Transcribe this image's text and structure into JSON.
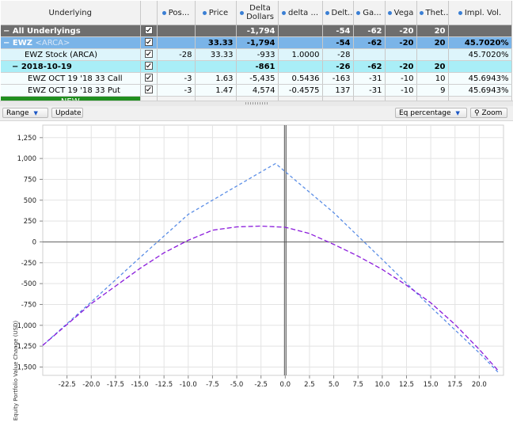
{
  "table": {
    "headers": {
      "underlying": "Underlying",
      "position": "Pos...",
      "price": "Price",
      "delta_dollars_1": "Delta",
      "delta_dollars_2": "Dollars",
      "delta_pct": "delta ...",
      "delta": "Delt...",
      "gamma": "Ga...",
      "vega": "Vega",
      "theta": "Thet...",
      "impl_vol": "Impl. Vol."
    },
    "rows": [
      {
        "type": "all",
        "name": "All Underlyings",
        "exch": "",
        "checked": true,
        "pos": "",
        "price": "",
        "ddollars": "-1,794",
        "dpct": "",
        "delta": "-54",
        "gamma": "-62",
        "vega": "-20",
        "theta": "20",
        "iv": ""
      },
      {
        "type": "ewz",
        "name": "EWZ",
        "exch": "<ARCA>",
        "checked": true,
        "pos": "",
        "price": "33.33",
        "ddollars": "-1,794",
        "dpct": "",
        "delta": "-54",
        "gamma": "-62",
        "vega": "-20",
        "theta": "20",
        "iv": "45.7020%"
      },
      {
        "type": "stock",
        "name": "EWZ Stock (ARCA)",
        "exch": "",
        "checked": true,
        "pos": "-28",
        "price": "33.33",
        "ddollars": "-933",
        "dpct": "1.0000",
        "delta": "-28",
        "gamma": "",
        "vega": "",
        "theta": "",
        "iv": "45.7020%"
      },
      {
        "type": "date",
        "name": "2018-10-19",
        "exch": "",
        "checked": true,
        "pos": "",
        "price": "",
        "ddollars": "-861",
        "dpct": "",
        "delta": "-26",
        "gamma": "-62",
        "vega": "-20",
        "theta": "20",
        "iv": ""
      },
      {
        "type": "opt",
        "name": "EWZ OCT 19 '18 33 Call",
        "exch": "",
        "checked": true,
        "pos": "-3",
        "price": "1.63",
        "ddollars": "-5,435",
        "dpct": "0.5436",
        "delta": "-163",
        "gamma": "-31",
        "vega": "-10",
        "theta": "10",
        "iv": "45.6943%"
      },
      {
        "type": "opt",
        "name": "EWZ OCT 19 '18 33 Put",
        "exch": "",
        "checked": true,
        "pos": "-3",
        "price": "1.47",
        "ddollars": "4,574",
        "dpct": "-0.4575",
        "delta": "137",
        "gamma": "-31",
        "vega": "-10",
        "theta": "9",
        "iv": "45.6943%"
      },
      {
        "type": "new",
        "name": "NEW",
        "exch": "",
        "checked": false,
        "pos": "",
        "price": "",
        "ddollars": "",
        "dpct": "",
        "delta": "",
        "gamma": "",
        "vega": "",
        "theta": "",
        "iv": ""
      }
    ]
  },
  "toolbar": {
    "range_label": "Range",
    "update_label": "Update",
    "mode_label": "Eq percentage",
    "zoom_label": "Zoom"
  },
  "chart_data": {
    "type": "line",
    "xlabel": "",
    "ylabel": "Equity Portfolio Value Change (USD)",
    "xlim": [
      -25,
      22.5
    ],
    "ylim": [
      -1600,
      1400
    ],
    "xticks": [
      -22.5,
      -20,
      -17.5,
      -15,
      -12.5,
      -10,
      -7.5,
      -5,
      -2.5,
      0,
      2.5,
      5,
      7.5,
      10,
      12.5,
      15,
      17.5,
      20
    ],
    "xtick_labels": [
      "-22.5",
      "-20.0",
      "-17.5",
      "-15.0",
      "-12.5",
      "-10.0",
      "-7.5",
      "-5.0",
      "-2.5",
      "0.0",
      "2.5",
      "5.0",
      "7.5",
      "10.0",
      "12.5",
      "15.0",
      "17.5",
      "20.0"
    ],
    "yticks": [
      1250,
      1000,
      750,
      500,
      250,
      0,
      -250,
      -500,
      -750,
      -1000,
      -1250,
      -1500
    ],
    "ytick_labels": [
      "1,250",
      "1,000",
      "750",
      "500",
      "250",
      "0",
      "-250",
      "-500",
      "-750",
      "-1,000",
      "-1,250",
      "-1,500"
    ],
    "current_x": 0,
    "grid": true,
    "series": [
      {
        "color": "#5b8ee6",
        "dash": "4,3",
        "x": [
          -25,
          -20,
          -15,
          -10,
          -5,
          -1,
          5,
          10,
          15,
          20,
          22
        ],
        "y": [
          -1240,
          -720,
          -190,
          330,
          670,
          940,
          350,
          -210,
          -780,
          -1330,
          -1570
        ]
      },
      {
        "color": "#8a1adb",
        "dash": "6,3",
        "x": [
          -25,
          -20,
          -15,
          -12.5,
          -10,
          -7.5,
          -5,
          -2.5,
          0,
          2.5,
          5,
          7.5,
          10,
          12.5,
          15,
          17.5,
          20,
          22
        ],
        "y": [
          -1240,
          -740,
          -320,
          -130,
          20,
          140,
          180,
          190,
          175,
          100,
          -30,
          -170,
          -330,
          -520,
          -730,
          -990,
          -1290,
          -1550
        ]
      }
    ]
  }
}
